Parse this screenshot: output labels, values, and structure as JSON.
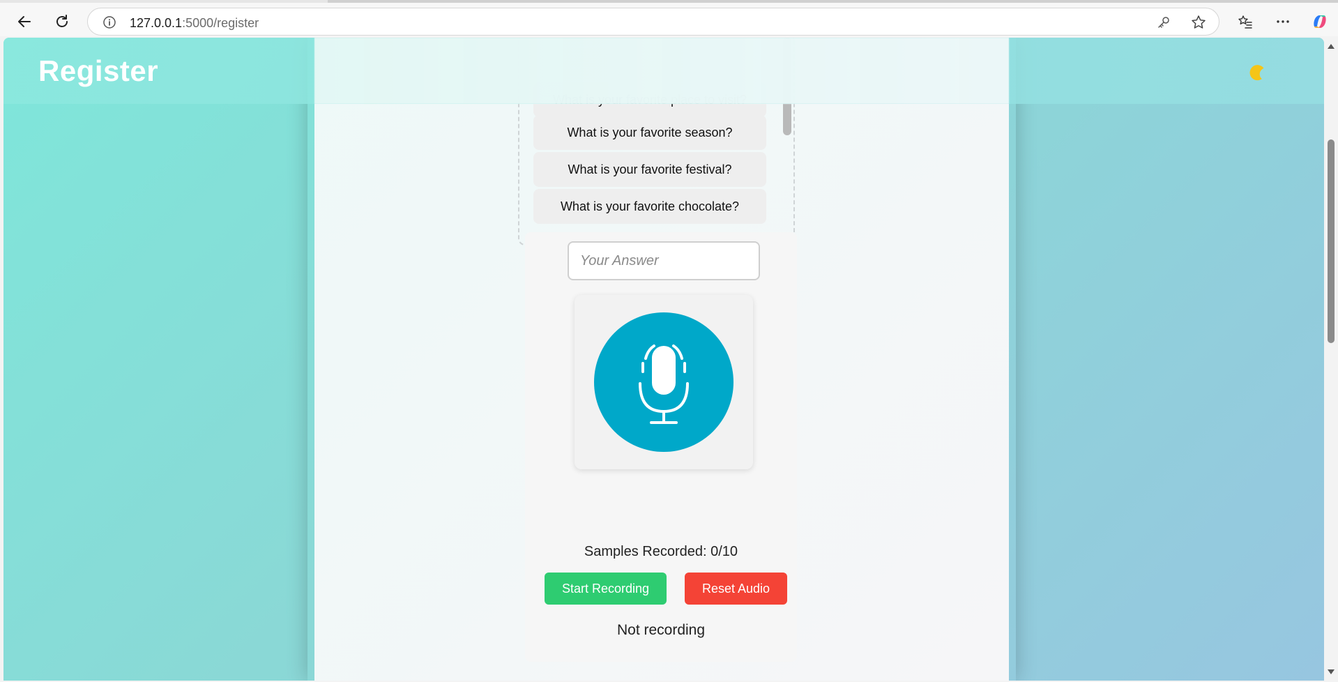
{
  "browser": {
    "url_host": "127.0.0.1",
    "url_path": ":5000/register"
  },
  "header": {
    "title": "Register",
    "theme_icon": "moon-icon"
  },
  "questions": [
    "What is your favorite place to visit?",
    "What is your favorite season?",
    "What is your favorite festival?",
    "What is your favorite chocolate?"
  ],
  "answer": {
    "placeholder": "Your Answer",
    "value": ""
  },
  "recording": {
    "samples_label": "Samples Recorded: 0/10",
    "start_label": "Start Recording",
    "reset_label": "Reset Audio",
    "status": "Not recording",
    "mic_color": "#00a8c9"
  },
  "colors": {
    "start_button": "#2ecc71",
    "reset_button": "#f44336"
  }
}
